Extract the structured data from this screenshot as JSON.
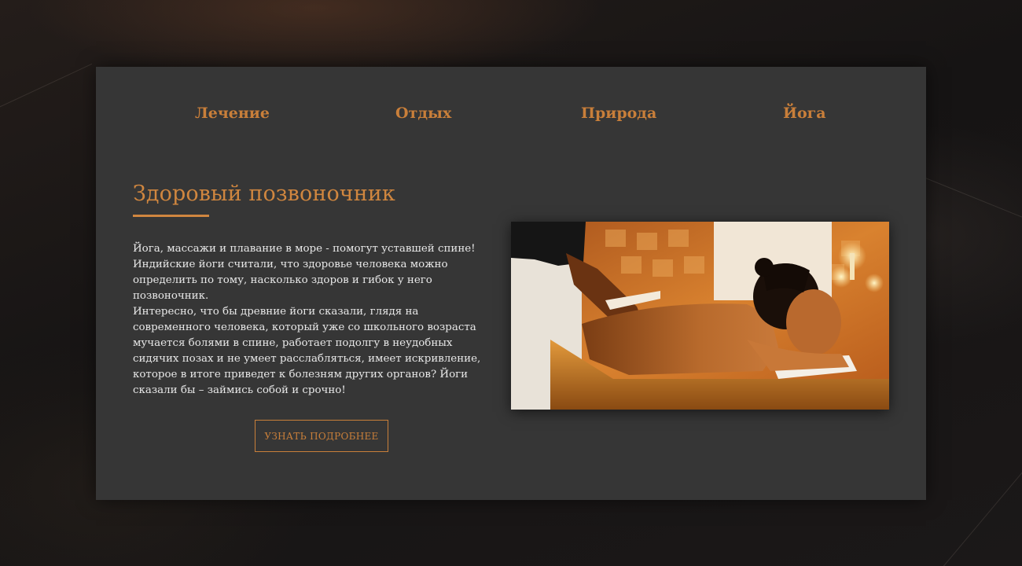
{
  "nav": {
    "items": [
      {
        "label": "Лечение"
      },
      {
        "label": "Отдых"
      },
      {
        "label": "Природа"
      },
      {
        "label": "Йога"
      }
    ]
  },
  "article": {
    "title": "Здоровый позвоночник",
    "paragraphs": [
      "Йога, массажи и плавание в море - помогут уставшей спине! Индийские йоги считали, что здоровье человека можно определить по тому, насколько здоров и гибок у него позвоночник.",
      "Интересно, что бы древние йоги сказали, глядя на современного человека, который уже со школьного возраста мучается болями в спине, работает подолгу в неудобных сидячих позах и не умеет расслабляться, имеет искривление, которое в итоге приведет к болезням других органов? Йоги сказали бы – займись собой и срочно!"
    ],
    "button_label": "УЗНАТЬ ПОДРОБНЕЕ"
  },
  "colors": {
    "accent": "#c97f3a",
    "panel": "#363636",
    "background": "#1a1818",
    "text": "#e8e8e8"
  }
}
